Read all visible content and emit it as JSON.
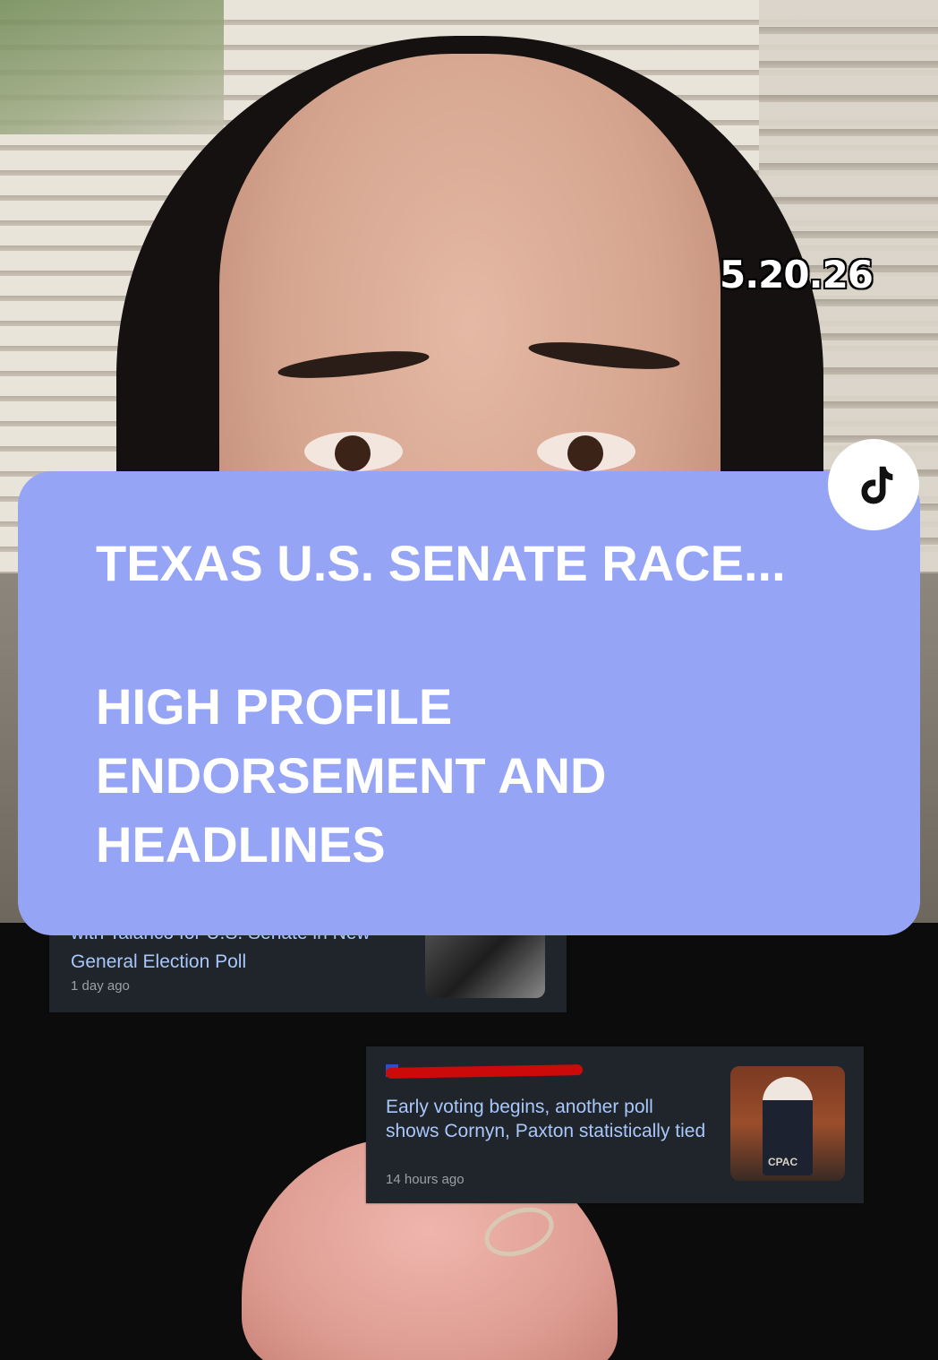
{
  "overlay": {
    "date": "5.20.26",
    "title_line_1": "TEXAS U.S. SENATE RACE...",
    "title_line_2": "HIGH PROFILE ENDORSEMENT AND HEADLINES",
    "banner_color": "#96a4f6"
  },
  "news_cards": [
    {
      "headline_partial": "with Talarico for U.S. Senate in New",
      "headline": "General Election Poll",
      "timestamp": "1 day ago"
    },
    {
      "headline": "Early voting begins, another poll shows Cornyn, Paxton statistically tied",
      "timestamp": "14 hours ago",
      "thumbnail_text": "CPAC"
    }
  ],
  "icons": {
    "platform_logo": "tiktok-icon"
  }
}
